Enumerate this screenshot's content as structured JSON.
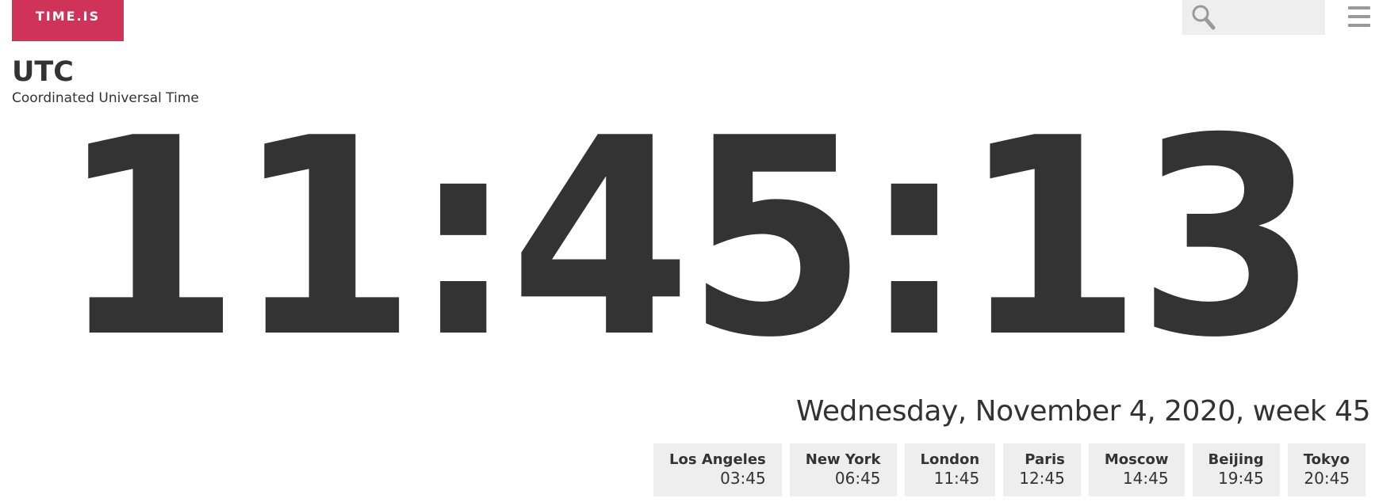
{
  "header": {
    "logo_text": "TIME.IS",
    "logo_color": "#cf3359",
    "search": {
      "placeholder": "",
      "value": "",
      "icon": "search-icon"
    },
    "menu_icon": "hamburger-menu-icon"
  },
  "zone": {
    "code": "UTC",
    "name": "Coordinated Universal Time"
  },
  "clock": {
    "time": "11:45:13"
  },
  "date": {
    "text": "Wednesday, November 4, 2020, week 45"
  },
  "cities": [
    {
      "name": "Los Angeles",
      "time": "03:45"
    },
    {
      "name": "New York",
      "time": "06:45"
    },
    {
      "name": "London",
      "time": "11:45"
    },
    {
      "name": "Paris",
      "time": "12:45"
    },
    {
      "name": "Moscow",
      "time": "14:45"
    },
    {
      "name": "Beijing",
      "time": "19:45"
    },
    {
      "name": "Tokyo",
      "time": "20:45"
    }
  ]
}
